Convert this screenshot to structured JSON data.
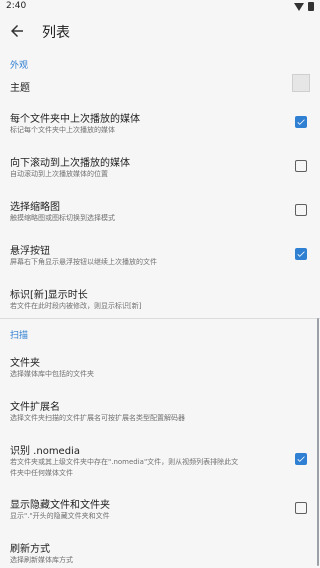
{
  "status": {
    "time": "2:40"
  },
  "toolbar": {
    "title": "列表",
    "back_icon": "arrow-left-icon"
  },
  "sections": {
    "appearance": {
      "header": "外观",
      "theme": {
        "title": "主题"
      },
      "last_played_each_folder": {
        "title": "每个文件夹中上次播放的媒体",
        "subtitle": "标记每个文件夹中上次播放的媒体",
        "checked": true
      },
      "scroll_to_last_played": {
        "title": "向下滚动到上次播放的媒体",
        "subtitle": "自动滚动到上次播放媒体的位置",
        "checked": false
      },
      "select_thumbnail": {
        "title": "选择缩略图",
        "subtitle": "触摸缩略图或图标切换到选择模式",
        "checked": false
      },
      "floating_button": {
        "title": "悬浮按钮",
        "subtitle": "屏幕右下角显示悬浮按钮以继续上次播放的文件",
        "checked": true
      },
      "new_label_duration": {
        "title": "标识[新]显示时长",
        "subtitle": "若文件在此时段内被修改，则显示标识[新]"
      }
    },
    "scan": {
      "header": "扫描",
      "folders": {
        "title": "文件夹",
        "subtitle": "选择媒体库中包括的文件夹"
      },
      "file_extensions": {
        "title": "文件扩展名",
        "subtitle": "选择文件夹扫描的文件扩展名可按扩展名类型配置解码器"
      },
      "recognize_nomedia": {
        "title": "识别 .nomedia",
        "subtitle_line1": "若文件夹或其上级文件夹中存在\".nomedia\"文件，则从视频列表排除此文",
        "subtitle_line2": "件夹中任何媒体文件",
        "checked": true
      },
      "show_hidden": {
        "title": "显示隐藏文件和文件夹",
        "subtitle": "显示\".\"开头的隐藏文件夹和文件",
        "checked": false
      },
      "refresh_method": {
        "title": "刷新方式",
        "subtitle": "选择刷新媒体库方式"
      }
    }
  },
  "colors": {
    "accent": "#2f7fd2",
    "background": "#f6f6f6",
    "divider": "#dcdcdc"
  }
}
